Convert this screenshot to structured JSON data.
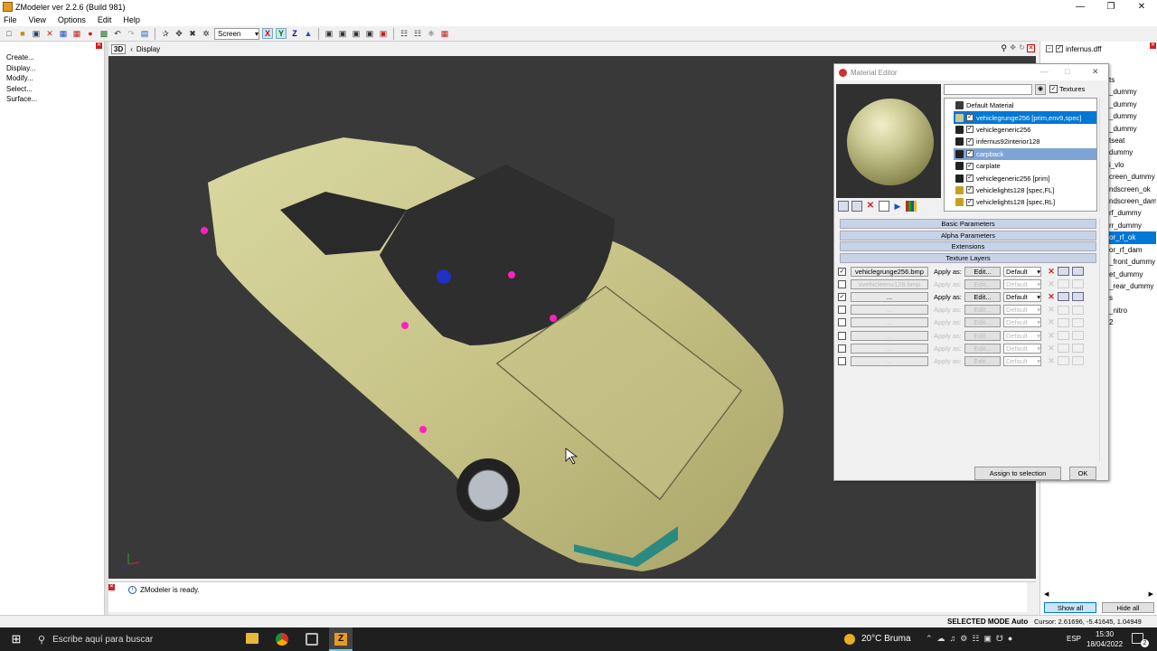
{
  "window": {
    "title": "ZModeler ver 2.2.6 (Build 981)"
  },
  "menu": [
    "File",
    "View",
    "Options",
    "Edit",
    "Help"
  ],
  "toolbar": {
    "coord_mode": "Screen",
    "axis_x": "X",
    "axis_y": "Y",
    "axis_z": "Z"
  },
  "left_panel": {
    "items": [
      "Create...",
      "Display...",
      "Modify...",
      "Select...",
      "Surface..."
    ]
  },
  "viewport": {
    "mode_label": "3D",
    "breadcrumb": "Display"
  },
  "log": {
    "message": "ZModeler is ready."
  },
  "right_panel": {
    "header": "infernus.dff",
    "items": [
      "ts",
      "_dummy",
      "_dummy",
      "_dummy",
      "",
      "_dummy",
      "",
      "tseat",
      "",
      "dummy",
      "i_vlo",
      "creen_dummy",
      "ndscreen_ok",
      "ndscreen_dam",
      "rf_dummy",
      "rr_dummy",
      "or_rf_ok",
      "or_rf_dam",
      "_front_dummy",
      "et_dummy",
      "_rear_dummy",
      "s",
      "_nitro",
      "2"
    ],
    "selected_index": 16,
    "show_all_label": "Show all",
    "hide_all_label": "Hide all"
  },
  "material_editor": {
    "title": "Material Editor",
    "textures_label": "Textures",
    "materials": [
      {
        "name": "Default Material",
        "swatch": "#3a3a3a",
        "check": false,
        "state": ""
      },
      {
        "name": "vehiclegrunge256 [prim,env9,spec]",
        "swatch": "#c8c890",
        "check": true,
        "state": "sel1"
      },
      {
        "name": "vehiclegeneric256",
        "swatch": "#222222",
        "check": true,
        "state": ""
      },
      {
        "name": "infernus92interior128",
        "swatch": "#222222",
        "check": true,
        "state": ""
      },
      {
        "name": "carpback",
        "swatch": "#222222",
        "check": true,
        "state": "sel2"
      },
      {
        "name": "carplate",
        "swatch": "#222222",
        "check": true,
        "state": ""
      },
      {
        "name": "vehiclegeneric256 [prim]",
        "swatch": "#222222",
        "check": true,
        "state": ""
      },
      {
        "name": "vehiclelights128 [spec,FL]",
        "swatch": "#c8a020",
        "check": true,
        "state": ""
      },
      {
        "name": "vehiclelights128 [spec,RL]",
        "swatch": "#c8a020",
        "check": true,
        "state": ""
      }
    ],
    "sections": [
      "Basic Parameters",
      "Alpha Parameters",
      "Extensions",
      "Texture Layers"
    ],
    "texture_layers": [
      {
        "checked": true,
        "name": "vehiclegrunge256.bmp",
        "apply": "Apply as:",
        "edit": "Edit...",
        "mode": "Default",
        "enabled": true
      },
      {
        "checked": false,
        "name": "xvehicleenv128.bmp",
        "apply": "Apply as:",
        "edit": "Edit...",
        "mode": "Default",
        "enabled": false
      },
      {
        "checked": true,
        "name": "...",
        "apply": "Apply as:",
        "edit": "Edit...",
        "mode": "Default",
        "enabled": true
      },
      {
        "checked": false,
        "name": "...",
        "apply": "Apply as:",
        "edit": "Edit...",
        "mode": "Default",
        "enabled": false
      },
      {
        "checked": false,
        "name": "...",
        "apply": "Apply as:",
        "edit": "Edit...",
        "mode": "Default",
        "enabled": false
      },
      {
        "checked": false,
        "name": "...",
        "apply": "Apply as:",
        "edit": "Edit...",
        "mode": "Default",
        "enabled": false
      },
      {
        "checked": false,
        "name": "...",
        "apply": "Apply as:",
        "edit": "Edit...",
        "mode": "Default",
        "enabled": false
      },
      {
        "checked": false,
        "name": "...",
        "apply": "Apply as:",
        "edit": "Edit...",
        "mode": "Default",
        "enabled": false
      }
    ],
    "assign_label": "Assign to selection",
    "ok_label": "OK"
  },
  "status": {
    "mode": "SELECTED MODE",
    "auto": "Auto",
    "cursor": "Cursor: 2.61696, -5.41645, 1.04949"
  },
  "taskbar": {
    "search_placeholder": "Escribe aquí para buscar",
    "weather": "20°C  Bruma",
    "lang": "ESP",
    "time": "15:30",
    "date": "18/04/2022",
    "notif_count": "2"
  }
}
